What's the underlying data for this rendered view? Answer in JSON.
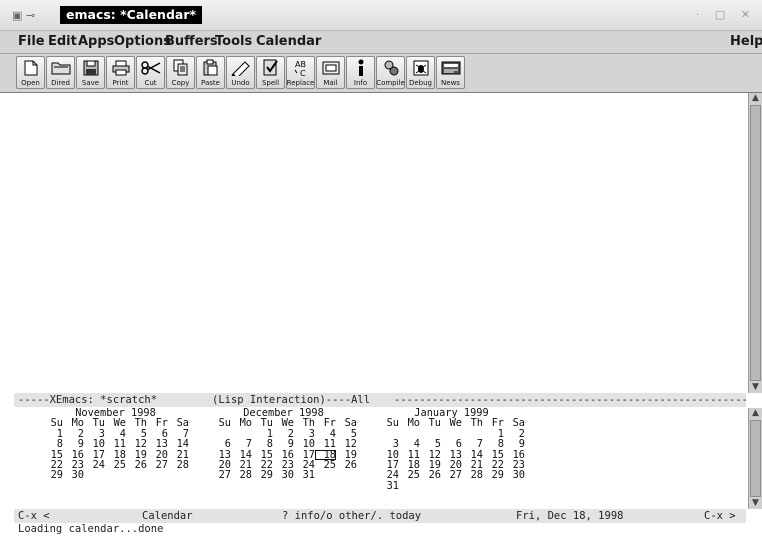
{
  "window": {
    "title": "emacs: *Calendar*"
  },
  "menubar": {
    "items": [
      "File",
      "Edit",
      "Apps",
      "Options",
      "Buffers",
      "Tools",
      "Calendar"
    ],
    "help": "Help"
  },
  "toolbar": {
    "buttons": [
      {
        "label": "Open",
        "icon": "open-file-icon"
      },
      {
        "label": "Dired",
        "icon": "folder-icon"
      },
      {
        "label": "Save",
        "icon": "save-icon"
      },
      {
        "label": "Print",
        "icon": "print-icon"
      },
      {
        "label": "Cut",
        "icon": "scissors-icon"
      },
      {
        "label": "Copy",
        "icon": "copy-icon"
      },
      {
        "label": "Paste",
        "icon": "paste-icon"
      },
      {
        "label": "Undo",
        "icon": "undo-icon"
      },
      {
        "label": "Spell",
        "icon": "spell-icon"
      },
      {
        "label": "Replace",
        "icon": "replace-icon"
      },
      {
        "label": "Mail",
        "icon": "mail-icon"
      },
      {
        "label": "Info",
        "icon": "info-icon"
      },
      {
        "label": "Compile",
        "icon": "compile-icon"
      },
      {
        "label": "Debug",
        "icon": "debug-icon"
      },
      {
        "label": "News",
        "icon": "news-icon"
      }
    ]
  },
  "scratch_modeline": {
    "lead": "-----XEmacs: *scratch*",
    "mode": "(Lisp Interaction)----All",
    "fill": "------------------------------------------------------------------------------------------"
  },
  "calendar": {
    "months": [
      {
        "header": "November 1998",
        "weekdays": "Su Mo Tu We Th Fr Sa",
        "rows": [
          [
            "1",
            "2",
            "3",
            "4",
            "5",
            "6",
            "7"
          ],
          [
            "8",
            "9",
            "10",
            "11",
            "12",
            "13",
            "14"
          ],
          [
            "15",
            "16",
            "17",
            "18",
            "19",
            "20",
            "21"
          ],
          [
            "22",
            "23",
            "24",
            "25",
            "26",
            "27",
            "28"
          ],
          [
            "29",
            "30",
            "",
            "",
            "",
            "",
            ""
          ]
        ]
      },
      {
        "header": "December 1998",
        "weekdays": "Su Mo Tu We Th Fr Sa",
        "rows": [
          [
            "",
            "",
            "1",
            "2",
            "3",
            "4",
            "5"
          ],
          [
            "6",
            "7",
            "8",
            "9",
            "10",
            "11",
            "12"
          ],
          [
            "13",
            "14",
            "15",
            "16",
            "17",
            "18",
            "19"
          ],
          [
            "20",
            "21",
            "22",
            "23",
            "24",
            "25",
            "26"
          ],
          [
            "27",
            "28",
            "29",
            "30",
            "31",
            "",
            ""
          ]
        ],
        "current_day": "18"
      },
      {
        "header": "January 1999",
        "weekdays": "Su Mo Tu We Th Fr Sa",
        "rows": [
          [
            "",
            "",
            "",
            "",
            "",
            "1",
            "2"
          ],
          [
            "3",
            "4",
            "5",
            "6",
            "7",
            "8",
            "9"
          ],
          [
            "10",
            "11",
            "12",
            "13",
            "14",
            "15",
            "16"
          ],
          [
            "17",
            "18",
            "19",
            "20",
            "21",
            "22",
            "23"
          ],
          [
            "24",
            "25",
            "26",
            "27",
            "28",
            "29",
            "30"
          ],
          [
            "31",
            "",
            "",
            "",
            "",
            "",
            ""
          ]
        ]
      }
    ]
  },
  "calendar_modeline": {
    "left": "C-x <",
    "name": "Calendar",
    "help": "? info/o other/. today",
    "date": "Fri, Dec 18, 1998",
    "right": "C-x >"
  },
  "echo_area": "Loading calendar...done"
}
